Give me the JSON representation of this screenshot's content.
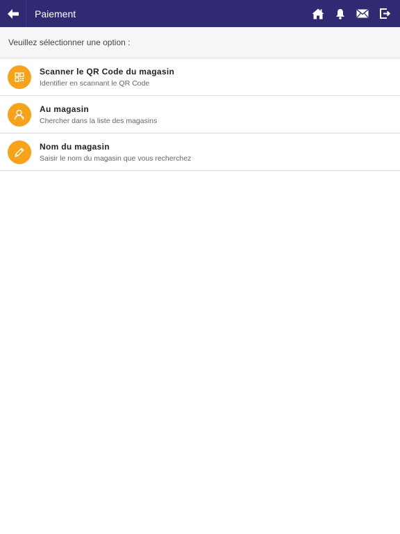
{
  "header": {
    "title": "Paiement",
    "icons": [
      "back-arrow-icon",
      "home-icon",
      "bell-icon",
      "mail-icon",
      "logout-icon"
    ]
  },
  "prompt": "Veuillez sélectionner une option :",
  "options": [
    {
      "title": "Scanner le QR Code du magasin",
      "subtitle": "Identifier en scannant le QR Code",
      "icon": "qr-code-icon"
    },
    {
      "title": "Au magasin",
      "subtitle": "Chercher dans la liste des magasins",
      "icon": "user-icon"
    },
    {
      "title": "Nom du magasin",
      "subtitle": "Saisir le nom du magasin que vous recherchez",
      "icon": "pencil-icon"
    }
  ],
  "colors": {
    "header_bg": "#2f2a72",
    "accent": "#f7a31a"
  }
}
